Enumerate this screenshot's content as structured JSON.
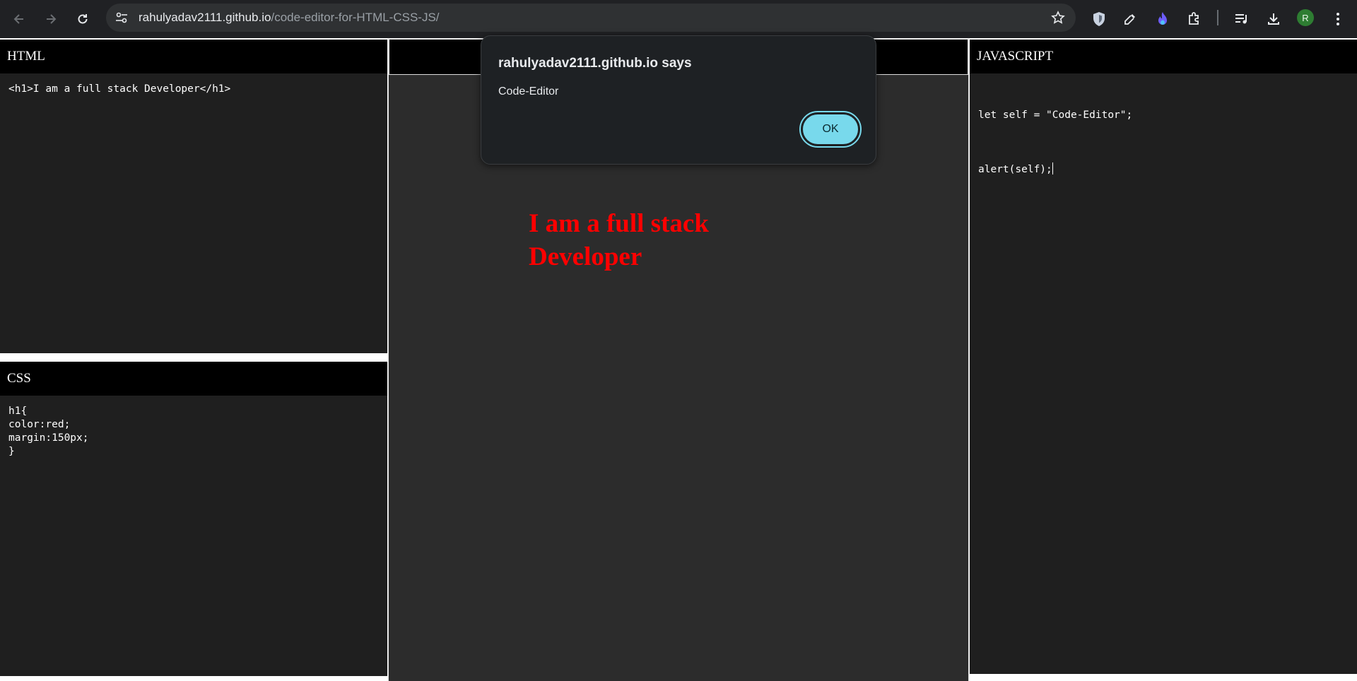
{
  "browser": {
    "url_host": "rahulyadav2111.github.io",
    "url_path": "/code-editor-for-HTML-CSS-JS/",
    "profile_initial": "R",
    "icons": [
      "back-arrow-icon",
      "forward-arrow-icon",
      "reload-icon",
      "site-settings-icon",
      "bookmark-star-icon",
      "shield-extension-icon",
      "eyedropper-extension-icon",
      "flame-extension-icon",
      "puzzle-extensions-icon",
      "media-queue-icon",
      "download-icon",
      "menu-dots-icon"
    ]
  },
  "editor": {
    "html": {
      "title": "HTML",
      "code": "<h1>I am a full stack Developer</h1>"
    },
    "css": {
      "title": "CSS",
      "code": "h1{\ncolor:red;\nmargin:150px;\n}"
    },
    "js": {
      "title": "JAVASCRIPT",
      "line1": "let self = \"Code-Editor\";",
      "line2": "alert(self);"
    }
  },
  "output": {
    "heading": "I am a full stack Developer",
    "heading_color": "#ff0000"
  },
  "dialog": {
    "title": "rahulyadav2111.github.io says",
    "message": "Code-Editor",
    "ok_label": "OK",
    "accent": "#78d9ec"
  }
}
